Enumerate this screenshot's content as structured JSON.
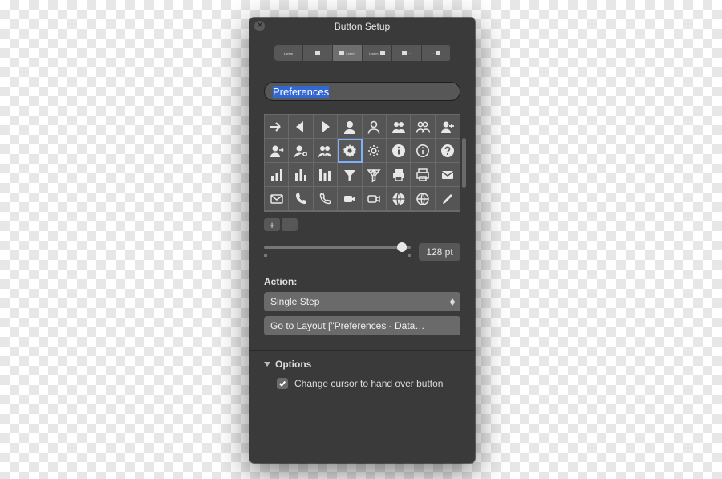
{
  "title": "Button Setup",
  "segments": [
    "Lorem",
    "",
    "",
    "Lorem",
    "",
    ""
  ],
  "segment_selected_index": 2,
  "name_value": "Preferences",
  "icons": [
    "arrow-right",
    "triangle-left",
    "triangle-right",
    "user",
    "user-outline",
    "users",
    "users-outline",
    "user-plus",
    "user-arrow",
    "user-gear",
    "user-link",
    "gear",
    "gear-outline",
    "info",
    "info-outline",
    "help",
    "bars",
    "bars-alt",
    "bars-3",
    "funnel",
    "funnel-split",
    "printer",
    "printer-outline",
    "mail",
    "mail-outline",
    "phone",
    "phone-outline",
    "video",
    "video-outline",
    "globe",
    "globe-outline",
    "pencil"
  ],
  "icon_selected_index": 11,
  "size_label": "128 pt",
  "action_label": "Action:",
  "action_type": "Single Step",
  "action_step": "Go to Layout [\"Preferences - Data…",
  "options_label": "Options",
  "checkbox_label": "Change cursor to hand over button",
  "checkbox_checked": true
}
